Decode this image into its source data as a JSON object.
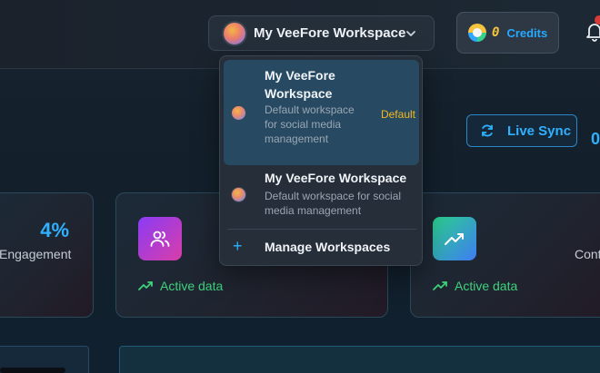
{
  "header": {
    "workspace_selector": {
      "title": "My VeeFore Workspace"
    },
    "credits": {
      "value": "0",
      "label": "Credits"
    }
  },
  "dropdown": {
    "workspaces": [
      {
        "name": "My VeeFore Workspace",
        "description": "Default workspace for social media management",
        "badge": "Default",
        "selected": true
      },
      {
        "name": "My VeeFore Workspace",
        "description": "Default workspace for social media management"
      }
    ],
    "manage_label": "Manage Workspaces",
    "manage_icon": "+"
  },
  "main": {
    "live_sync_label": "Live Sync",
    "edge_value": "0",
    "cards": [
      {
        "value": "4%",
        "label": "Engagement"
      },
      {
        "icon": "users-icon",
        "status": "Active data"
      },
      {
        "icon": "trending-up-icon",
        "status": "Active data",
        "label_fragment": "Cont"
      }
    ]
  },
  "colors": {
    "accent_blue": "#2fb1ff",
    "active_green": "#3ed27c",
    "credits_yellow": "#f6c43c",
    "default_badge": "#f2b81f"
  }
}
